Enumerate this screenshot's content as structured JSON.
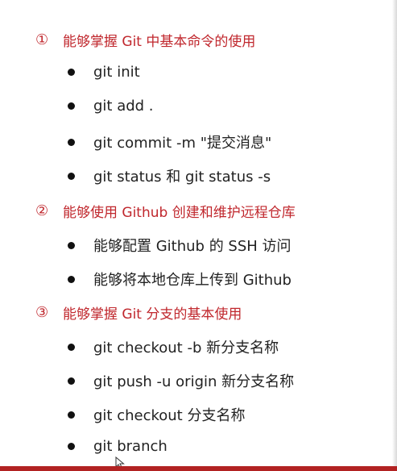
{
  "sections": [
    {
      "num": "①",
      "title": "能够掌握 Git 中基本命令的使用",
      "items": [
        "git init",
        "git add .",
        "git commit -m \"提交消息\"",
        "git status 和 git status -s"
      ]
    },
    {
      "num": "②",
      "title": "能够使用 Github 创建和维护远程仓库",
      "items": [
        "能够配置 Github 的 SSH 访问",
        "能够将本地仓库上传到 Github"
      ]
    },
    {
      "num": "③",
      "title": "能够掌握 Git 分支的基本使用",
      "items": [
        "git checkout -b 新分支名称",
        "git push -u origin 新分支名称",
        "git checkout 分支名称",
        "git branch"
      ]
    }
  ],
  "colors": {
    "heading": "#c0272d",
    "text": "#222222",
    "bottom_bar": "#b22222"
  },
  "icons": {
    "cursor": "mouse-pointer-icon",
    "bullet": "bullet-dot-icon"
  }
}
